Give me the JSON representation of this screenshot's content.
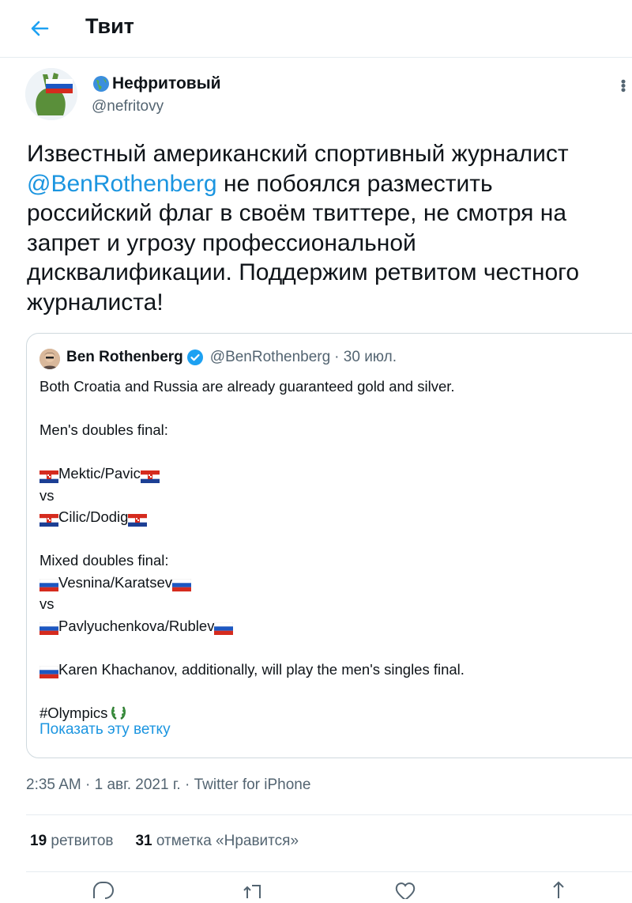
{
  "header": {
    "title": "Твит"
  },
  "author": {
    "name": "Нефритовый",
    "handle": "@nefritovy"
  },
  "tweet": {
    "lines": [
      {
        "pre": "Известный американский спортивный журналист"
      },
      {
        "mention": "@BenRothenberg",
        "post": " не побоялся разместить"
      },
      {
        "pre": "российский флаг в своём твиттере, не смотря на"
      },
      {
        "pre": "запрет и угрозу профессиональной"
      },
      {
        "pre": "дисквалификации. Поддержим ретвитом честного"
      },
      {
        "pre": "журналиста!"
      }
    ]
  },
  "quote": {
    "name": "Ben Rothenberg",
    "handle": "@BenRothenberg",
    "date": "· 30 июл.",
    "lines": [
      "Both Croatia and Russia are already guaranteed gold and silver.",
      "",
      "Men's doubles final:",
      "",
      "Mektic/Pavic",
      "vs",
      "Cilic/Dodig",
      "",
      "Mixed doubles final:",
      "Vesnina/Karatsev",
      "vs",
      "Pavlyuchenkova/Rublev",
      "",
      "Karen Khachanov, additionally, will play the men's singles final.",
      "",
      "#Olympics"
    ],
    "show_thread": "Показать эту ветку"
  },
  "timestamp": "2:35 AM · 1 авг. 2021 г. · Twitter for iPhone",
  "stats": {
    "retweets_count": "19",
    "retweets_label": "ретвитов",
    "likes_count": "31",
    "likes_label": "отметка «Нравится»"
  },
  "icons": {
    "back": "arrow-left-icon",
    "globe": "globe-icon",
    "verified": "verified-badge-icon",
    "more": "more-vertical-icon",
    "reply": "reply-icon",
    "retweet": "retweet-icon",
    "like": "heart-icon",
    "share": "share-icon"
  },
  "colors": {
    "accent": "#1da1f2",
    "link": "#1b95e0",
    "muted": "#536471",
    "border": "#cfd9de"
  }
}
